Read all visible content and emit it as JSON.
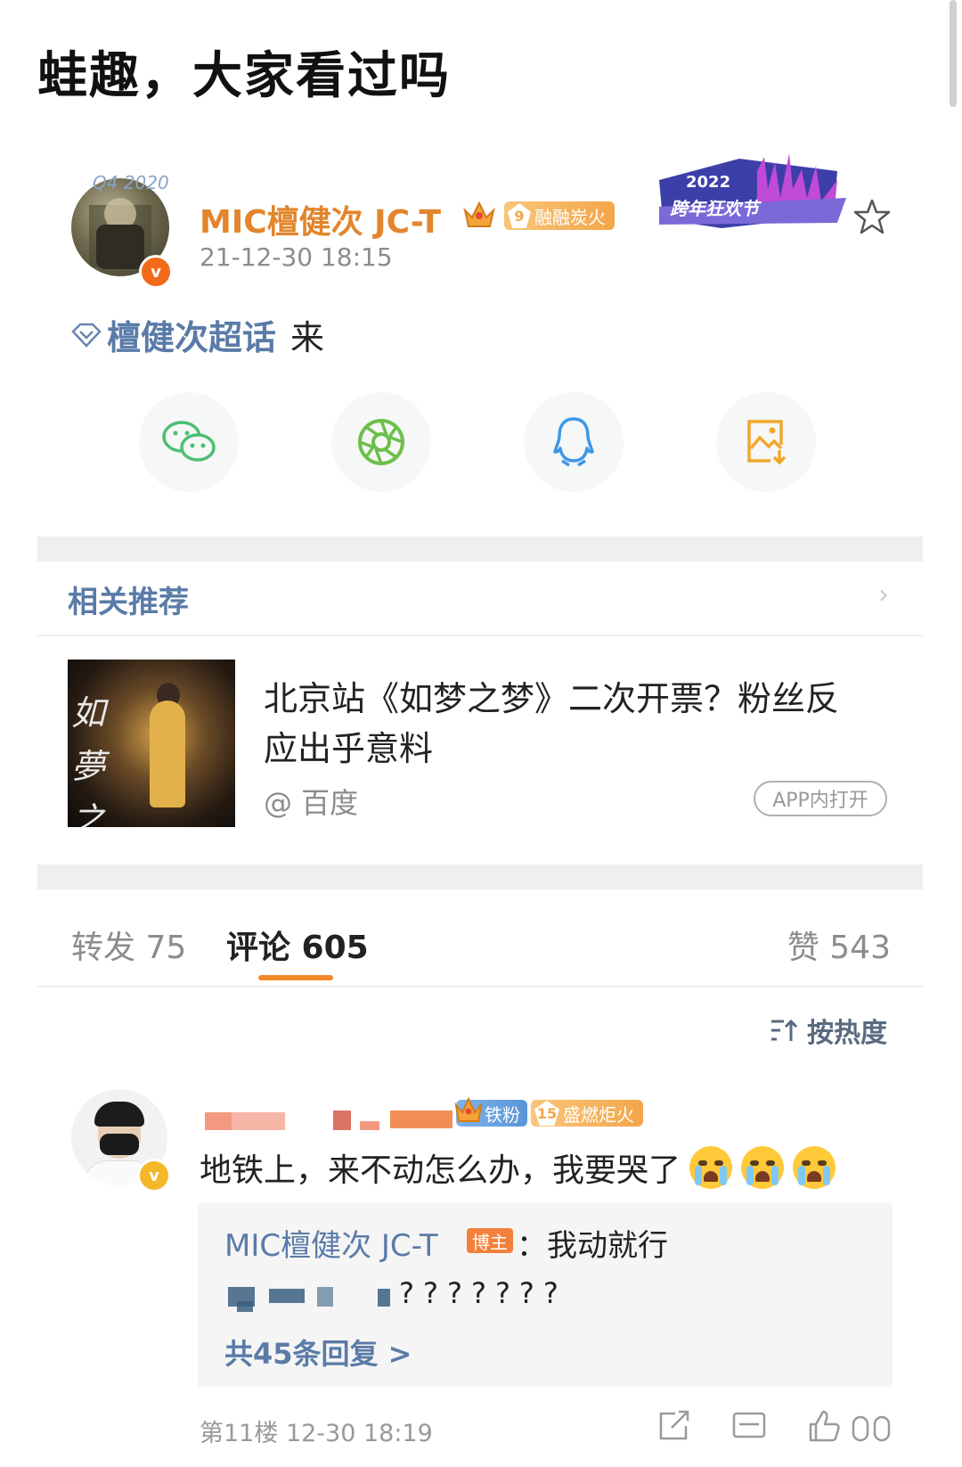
{
  "caption": "蛙趣，大家看过吗",
  "post": {
    "author": "MIC檀健次 JC-T",
    "fan_level": "9",
    "fan_badge": "融融炭火",
    "avatar_deco": "Q4 2020",
    "time": "21-12-30 18:15",
    "event_banner": {
      "year": "2022",
      "text": "跨年狂欢节"
    },
    "topic": "檀健次超话",
    "content": "来"
  },
  "share": [
    {
      "name": "wechat",
      "icon": "wechat-icon",
      "color": "#4bbf73"
    },
    {
      "name": "moments",
      "icon": "moments-icon",
      "color": "#6cc04a"
    },
    {
      "name": "qq",
      "icon": "qq-icon",
      "color": "#3d98e8"
    },
    {
      "name": "save-image",
      "icon": "save-image-icon",
      "color": "#f2a72a"
    }
  ],
  "recommend": {
    "title": "相关推荐",
    "headline": "北京站《如梦之梦》二次开票？粉丝反应出乎意料",
    "source": "@ 百度",
    "app_button": "APP内打开",
    "thumb_text": "如夢之夢"
  },
  "tabs": {
    "repost": "转发 75",
    "comment": "评论 605",
    "like": "赞 543",
    "sort": "按热度"
  },
  "comment": {
    "iron_badge": "铁粉",
    "fan_level": "15",
    "fan_badge": "盛燃炬火",
    "text": "地铁上，来不动怎么办，我要哭了",
    "reply_author": "MIC檀健次 JC-T",
    "blogger_tag": "博主",
    "reply_text": "：我动就行",
    "reply2_text": "???????",
    "more_replies": "共45条回复 >",
    "floor": "第11楼  12-30 18:19"
  },
  "colors": {
    "accent_orange": "#f38a2a",
    "link_blue": "#5a7ba7",
    "author_orange": "#e2852c"
  }
}
